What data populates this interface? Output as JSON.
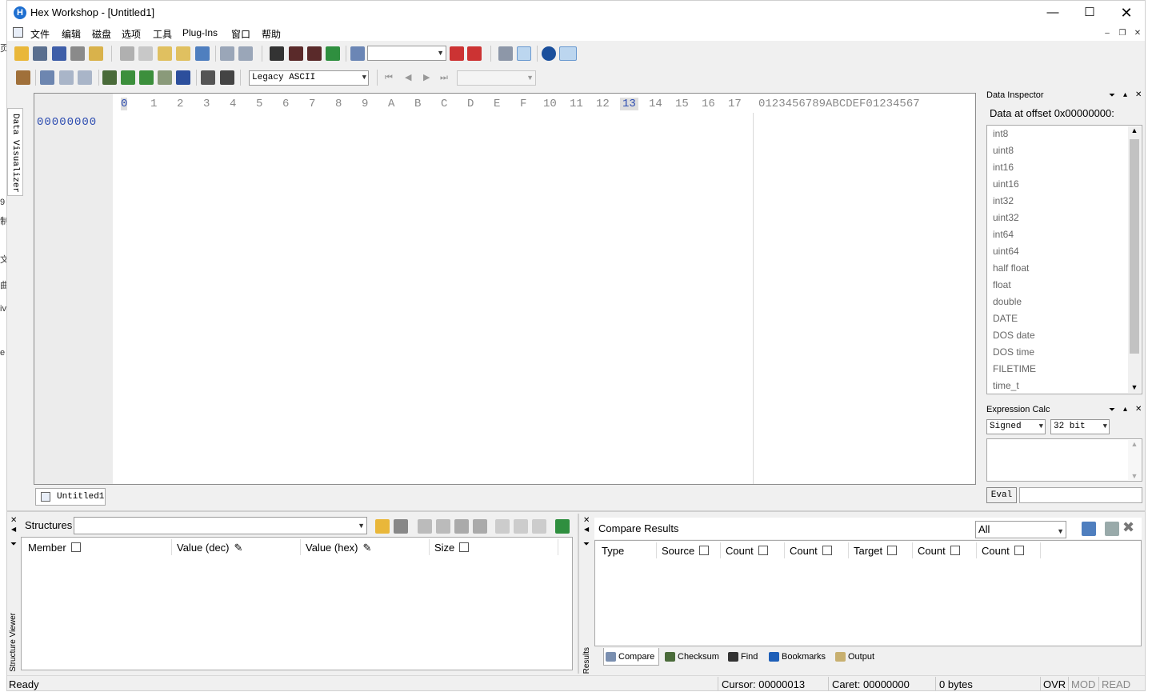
{
  "window": {
    "title": "Hex Workshop - [Untitled1]",
    "app_icon": "H"
  },
  "menu": [
    "文件",
    "编辑",
    "磁盘",
    "选项",
    "工具",
    "Plug-Ins",
    "窗口",
    "帮助"
  ],
  "toolbar": {
    "encoding": "Legacy ASCII",
    "search_value": "",
    "nav_value": ""
  },
  "sidebar": {
    "data_visualizer": "Data Visualizer",
    "structure_viewer": "Structure Viewer",
    "results": "Results"
  },
  "editor": {
    "columns": [
      "0",
      "1",
      "2",
      "3",
      "4",
      "5",
      "6",
      "7",
      "8",
      "9",
      "A",
      "B",
      "C",
      "D",
      "E",
      "F",
      "10",
      "11",
      "12",
      "13",
      "14",
      "15",
      "16",
      "17"
    ],
    "ascii_header": "0123456789ABCDEF01234567",
    "offset": "00000000",
    "tab": "Untitled1"
  },
  "inspector": {
    "title": "Data Inspector",
    "offset_label": "Data at offset 0x00000000:",
    "types": [
      "int8",
      "uint8",
      "int16",
      "uint16",
      "int32",
      "uint32",
      "int64",
      "uint64",
      "half float",
      "float",
      "double",
      "DATE",
      "DOS date",
      "DOS time",
      "FILETIME",
      "time_t"
    ]
  },
  "expr": {
    "title": "Expression Calc",
    "sign": "Signed",
    "bits": "32 bit",
    "eval": "Eval"
  },
  "structures": {
    "label": "Structures",
    "headers": [
      "Member",
      "Value (dec)",
      "Value (hex)",
      "Size"
    ]
  },
  "compare": {
    "title": "Compare Results",
    "filter": "All",
    "headers": [
      "Type",
      "Source",
      "Count",
      "Count",
      "Target",
      "Count",
      "Count"
    ]
  },
  "tabs": [
    "Compare",
    "Checksum",
    "Find",
    "Bookmarks",
    "Output"
  ],
  "status": {
    "ready": "Ready",
    "cursor": "Cursor: 00000013",
    "caret": "Caret: 00000000",
    "size": "0 bytes",
    "ovr": "OVR",
    "mod": "MOD",
    "read": "READ"
  },
  "edge_glyphs": [
    "页",
    "9",
    "制",
    "文",
    "曲",
    "iv",
    "e"
  ]
}
